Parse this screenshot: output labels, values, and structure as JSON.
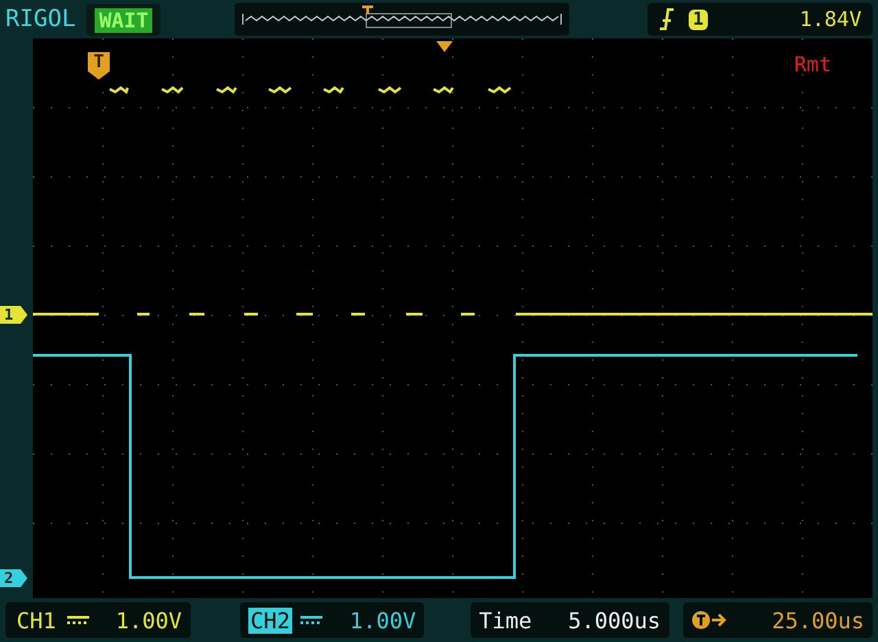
{
  "header": {
    "brand": "RIGOL",
    "status": "WAIT"
  },
  "trigger": {
    "source": "1",
    "level": "1.84V"
  },
  "screen": {
    "trigger_marker": "T",
    "remote": "Rmt"
  },
  "channels": [
    {
      "label": "CH1",
      "scale": "1.00V",
      "selected": false,
      "color": "#e4e437",
      "marker": "1"
    },
    {
      "label": "CH2",
      "scale": "1.00V",
      "selected": true,
      "color": "#36d0dc",
      "marker": "2"
    }
  ],
  "timebase": {
    "label": "Time",
    "value": "5.000us"
  },
  "delay": {
    "value": "25.00us"
  }
}
